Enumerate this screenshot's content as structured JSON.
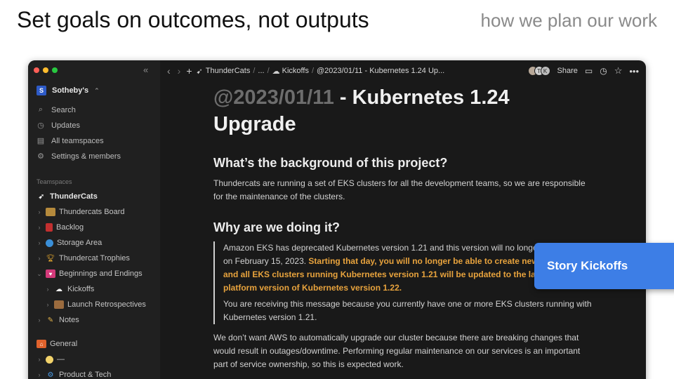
{
  "slide": {
    "title": "Set goals on outcomes, not outputs",
    "subtitle": "how we plan our work"
  },
  "window": {
    "traffic_colors": [
      "#ff5f57",
      "#febc2e",
      "#28c840"
    ]
  },
  "sidebar": {
    "workspace": {
      "initial": "S",
      "name": "Sotheby's"
    },
    "nav": [
      {
        "label": "Search",
        "icon": "search-icon"
      },
      {
        "label": "Updates",
        "icon": "clock-icon"
      },
      {
        "label": "All teamspaces",
        "icon": "building-icon"
      },
      {
        "label": "Settings & members",
        "icon": "gear-icon"
      }
    ],
    "teamspaces_label": "Teamspaces",
    "teamspace": "ThunderCats",
    "tree": [
      {
        "label": "Thundercats Board",
        "icon": "folder-icon",
        "level": 0
      },
      {
        "label": "Backlog",
        "icon": "red-book-icon",
        "level": 0
      },
      {
        "label": "Storage Area",
        "icon": "globe-icon",
        "level": 0
      },
      {
        "label": "Thundercat Trophies",
        "icon": "trophy-icon",
        "level": 0
      },
      {
        "label": "Beginnings and Endings",
        "icon": "heart-box-icon",
        "level": 0,
        "expanded": true
      },
      {
        "label": "Kickoffs",
        "icon": "cloud-icon",
        "level": 1
      },
      {
        "label": "Launch Retrospectives",
        "icon": "bricks-icon",
        "level": 1
      },
      {
        "label": "Notes",
        "icon": "pencil-icon",
        "level": 0
      }
    ],
    "general": "General",
    "extra": [
      {
        "label": "—",
        "icon": "face-icon"
      },
      {
        "label": "Product & Tech",
        "icon": "gear-blue-icon"
      }
    ]
  },
  "topbar": {
    "breadcrumb": [
      "ThunderCats",
      "...",
      "Kickoffs",
      "@2023/01/11 - Kubernetes 1.24 Up..."
    ],
    "avatars": [
      "",
      "T",
      "K"
    ],
    "share": "Share"
  },
  "page": {
    "title_date": "@2023/01/11",
    "title_rest": " - Kubernetes 1.24",
    "title_line2": "Upgrade",
    "h_background": "What’s the background of this project?",
    "p_background": "Thundercats are running a set of EKS clusters for all the development teams, so we are responsible for the maintenance of the clusters.",
    "h_why": "Why are we doing it?",
    "quote_plain1": "Amazon EKS has deprecated Kubernetes version 1.21 and this version will no longer be supported on February 15, 2023. ",
    "quote_highlight": "Starting that day, you will no longer be able to create new 1.21 clusters and all EKS clusters running Kubernetes version 1.21 will be updated to the latest available platform version of Kubernetes version 1.22.",
    "quote_plain2": "You are receiving this message because you currently have one or more EKS clusters running with Kubernetes version 1.21.",
    "p_last": "We don’t want AWS to automatically upgrade our cluster because there are breaking changes that would result in outages/downtime. Performing regular maintenance on our services is an important part of service ownership, so this is expected work."
  },
  "callout": {
    "label": "Story Kickoffs",
    "color": "#3d7ee6"
  }
}
